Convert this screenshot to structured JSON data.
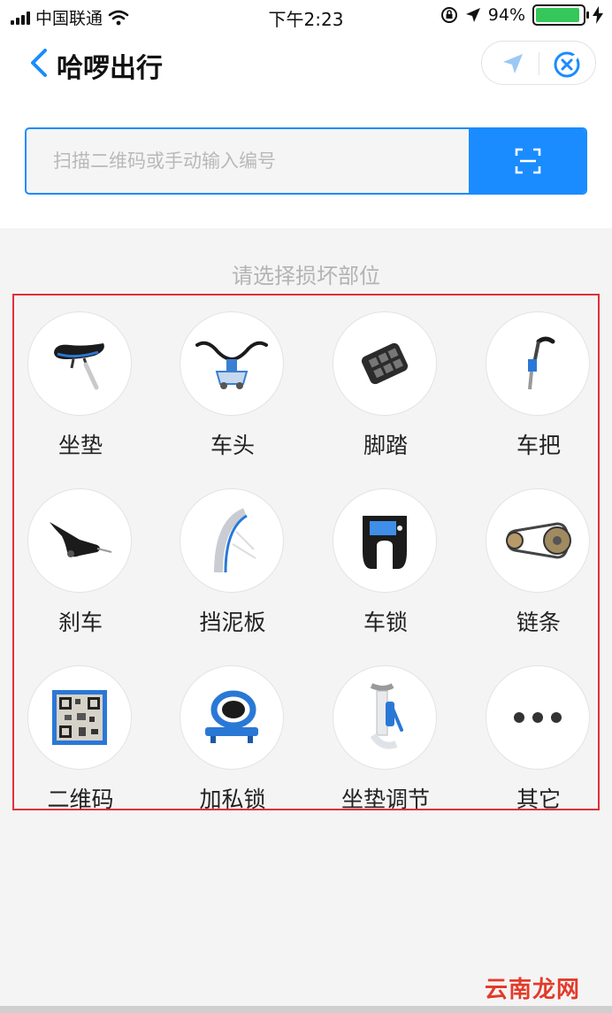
{
  "status_bar": {
    "carrier": "中国联通",
    "time": "下午2:23",
    "battery_percent": "94%",
    "battery_level": 0.94
  },
  "header": {
    "title": "哈啰出行"
  },
  "search": {
    "placeholder": "扫描二维码或手动输入编号"
  },
  "section": {
    "title": "请选择损坏部位"
  },
  "parts": [
    {
      "label": "坐垫"
    },
    {
      "label": "车头"
    },
    {
      "label": "脚踏"
    },
    {
      "label": "车把"
    },
    {
      "label": "刹车"
    },
    {
      "label": "挡泥板"
    },
    {
      "label": "车锁"
    },
    {
      "label": "链条"
    },
    {
      "label": "二维码"
    },
    {
      "label": "加私锁"
    },
    {
      "label": "坐垫调节"
    },
    {
      "label": "其它"
    }
  ],
  "watermark": "云南龙网",
  "colors": {
    "accent": "#1a8cff",
    "frame": "#e0303a",
    "battery": "#35c759"
  }
}
